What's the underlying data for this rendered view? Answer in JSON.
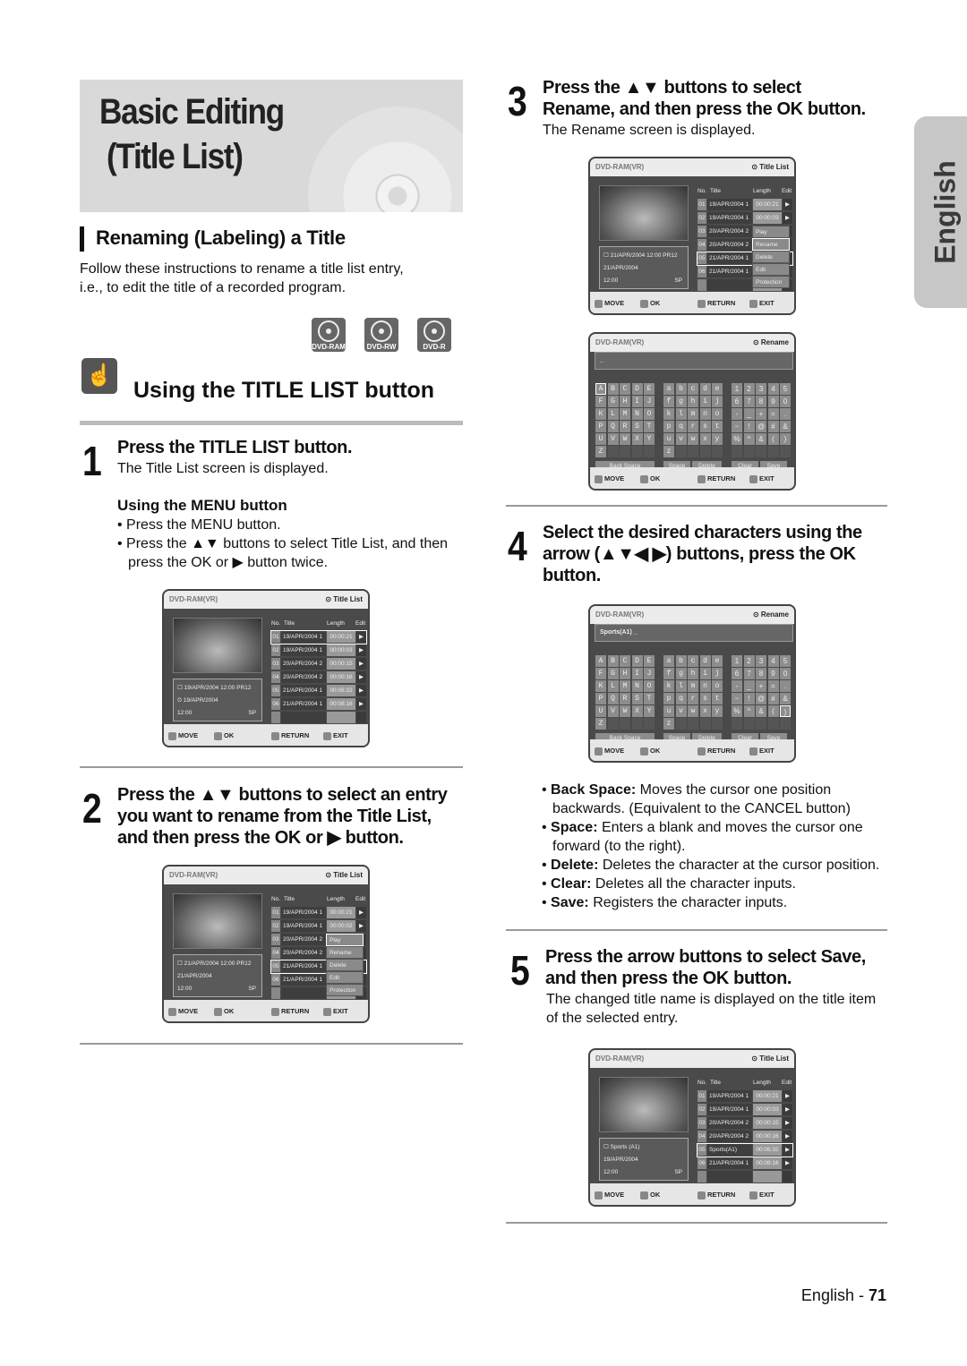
{
  "header": {
    "title_line1": "Basic Editing",
    "title_line2": "(Title List)"
  },
  "side_tab": "English",
  "section": {
    "title": "Renaming (Labeling) a Title",
    "intro_line1": "Follow these instructions to rename a title list entry,",
    "intro_line2": "i.e., to edit the title of a recorded program.",
    "discs": [
      "DVD-RAM",
      "DVD-RW",
      "DVD-R"
    ],
    "subsection_title": "Using the TITLE LIST button"
  },
  "steps": {
    "s1": {
      "num": "1",
      "heading": "Press the TITLE LIST button.",
      "sub": "The Title List screen is displayed.",
      "menu_heading": "Using the MENU button",
      "bullets": [
        "Press the MENU button.",
        "Press the ▲▼ buttons to select Title List, and then",
        "press the OK or ▶ button twice."
      ]
    },
    "s2": {
      "num": "2",
      "lines": [
        "Press the ▲▼ buttons to select an entry",
        "you want to rename from the Title List,",
        "and then press the OK or ▶ button."
      ]
    },
    "s3": {
      "num": "3",
      "lines": [
        "Press the ▲▼ buttons to select",
        "Rename, and then press the OK button."
      ],
      "sub": "The Rename screen is displayed."
    },
    "s4": {
      "num": "4",
      "lines": [
        "Select the desired characters using the",
        "arrow (▲▼◀ ▶) buttons, press the OK",
        "button."
      ]
    },
    "s5": {
      "num": "5",
      "lines": [
        "Press the arrow buttons to select Save,",
        "and then press the OK button."
      ],
      "sub": [
        "The changed title name is displayed on the title item",
        "of the selected entry."
      ]
    }
  },
  "definitions": [
    {
      "term": "Back Space:",
      "text": "Moves the cursor one position",
      "cont": "backwards. (Equivalent to the CANCEL button)"
    },
    {
      "term": "Space:",
      "text": "Enters a blank and moves the cursor one",
      "cont": "forward (to the right)."
    },
    {
      "term": "Delete:",
      "text": "Deletes the character at the cursor position.",
      "cont": ""
    },
    {
      "term": "Clear:",
      "text": "Deletes all the character inputs.",
      "cont": ""
    },
    {
      "term": "Save:",
      "text": "Registers the character inputs.",
      "cont": ""
    }
  ],
  "footer": {
    "lang": "English - ",
    "page": "71"
  },
  "screens": [
    {
      "kind": "list",
      "header_left": "DVD-RAM(VR)",
      "header_right": "⊙ Title List",
      "columns": [
        "No.",
        "Title",
        "Length",
        "Edit"
      ],
      "rows": [
        [
          "01",
          "19/APR/2004 1",
          "00:00:21"
        ],
        [
          "02",
          "19/APR/2004 1",
          "00:00:03"
        ],
        [
          "03",
          "20/APR/2004 2",
          "00:00:15"
        ],
        [
          "04",
          "20/APR/2004 2",
          "00:00:16"
        ],
        [
          "05",
          "21/APR/2004 1",
          "00:06:32"
        ],
        [
          "06",
          "21/APR/2004 1",
          "00:08:16"
        ]
      ],
      "selected_row": 0,
      "info": [
        "☐ 19/APR/2004 12:00 PR12",
        "⏲ 19/APR/2004",
        "12:00",
        "SP"
      ],
      "footer": [
        "MOVE",
        "OK",
        "RETURN",
        "EXIT"
      ]
    },
    {
      "kind": "list",
      "header_left": "DVD-RAM(VR)",
      "header_right": "⊙ Title List",
      "columns": [
        "No.",
        "Title",
        "Length",
        "Edit"
      ],
      "rows": [
        [
          "01",
          "19/APR/2004 1",
          "00:00:21"
        ],
        [
          "02",
          "19/APR/2004 1",
          "00:00:02"
        ],
        [
          "03",
          "20/APR/2004 2",
          ""
        ],
        [
          "04",
          "20/APR/2004 2",
          ""
        ],
        [
          "05",
          "21/APR/2004 1",
          ""
        ],
        [
          "06",
          "21/APR/2004 1",
          ""
        ]
      ],
      "selected_row": 4,
      "info": [
        "☐ 21/APR/2004 12:00 PR12",
        "21/APR/2004",
        "12:00",
        "SP"
      ],
      "menu": [
        "Play",
        "Rename",
        "Delete",
        "Edit",
        "Protection"
      ],
      "menu_selected": 0,
      "footer": [
        "MOVE",
        "OK",
        "RETURN",
        "EXIT"
      ]
    },
    {
      "kind": "list",
      "header_left": "DVD-RAM(VR)",
      "header_right": "⊙ Title List",
      "columns": [
        "No.",
        "Title",
        "Length",
        "Edit"
      ],
      "rows": [
        [
          "01",
          "19/APR/2004 1",
          "00:00:21"
        ],
        [
          "02",
          "19/APR/2004 1",
          "00:00:03"
        ],
        [
          "03",
          "20/APR/2004 2",
          ""
        ],
        [
          "04",
          "20/APR/2004 2",
          ""
        ],
        [
          "05",
          "21/APR/2004 1",
          ""
        ],
        [
          "06",
          "21/APR/2004 1",
          ""
        ]
      ],
      "selected_row": 4,
      "info": [
        "☐ 21/APR/2004 12:00 PR12",
        "21/APR/2004",
        "12:00",
        "SP"
      ],
      "menu": [
        "Play",
        "Rename",
        "Delete",
        "Edit",
        "Protection"
      ],
      "menu_selected": 1,
      "footer": [
        "MOVE",
        "OK",
        "RETURN",
        "EXIT"
      ]
    },
    {
      "kind": "rename",
      "header_left": "DVD-RAM(VR)",
      "header_right": "⊙ Rename",
      "input": "_",
      "upper": [
        "ABCDE",
        "FGHIJ",
        "KLMNO",
        "PQRST",
        "UVWXY",
        "Z"
      ],
      "lower": [
        "abcde",
        "fghij",
        "klmno",
        "pqrst",
        "uvwxy",
        "z"
      ],
      "symbols": [
        [
          "1",
          "2",
          "3",
          "4",
          "5"
        ],
        [
          "6",
          "7",
          "8",
          "9",
          "0"
        ],
        [
          "-",
          "_",
          "+",
          "=",
          "."
        ],
        [
          "~",
          "!",
          "@",
          "#",
          "&"
        ],
        [
          "%",
          "^",
          "&",
          "(",
          ")"
        ]
      ],
      "buttons": [
        "Back Space",
        "Space",
        "Delete",
        "Clear",
        "Save"
      ],
      "selected_key": "A",
      "footer": [
        "MOVE",
        "OK",
        "RETURN",
        "EXIT"
      ]
    },
    {
      "kind": "rename",
      "header_left": "DVD-RAM(VR)",
      "header_right": "⊙ Rename",
      "input": "Sports(A1) _",
      "upper": [
        "ABCDE",
        "FGHIJ",
        "KLMNO",
        "PQRST",
        "UVWXY",
        "Z"
      ],
      "lower": [
        "abcde",
        "fghij",
        "klmno",
        "pqrst",
        "uvwxy",
        "z"
      ],
      "symbols": [
        [
          "1",
          "2",
          "3",
          "4",
          "5"
        ],
        [
          "6",
          "7",
          "8",
          "9",
          "0"
        ],
        [
          "-",
          "_",
          "+",
          "=",
          "."
        ],
        [
          "~",
          "!",
          "@",
          "#",
          "&"
        ],
        [
          "%",
          "^",
          "&",
          "(",
          ")"
        ]
      ],
      "buttons": [
        "Back Space",
        "Space",
        "Delete",
        "Clear",
        "Save"
      ],
      "selected_key": ")",
      "footer": [
        "MOVE",
        "OK",
        "RETURN",
        "EXIT"
      ]
    },
    {
      "kind": "list",
      "header_left": "DVD-RAM(VR)",
      "header_right": "⊙ Title List",
      "columns": [
        "No.",
        "Title",
        "Length",
        "Edit"
      ],
      "rows": [
        [
          "01",
          "19/APR/2004 1",
          "00:00:21"
        ],
        [
          "02",
          "19/APR/2004 1",
          "00:00:03"
        ],
        [
          "03",
          "20/APR/2004 2",
          "00:00:15"
        ],
        [
          "04",
          "20/APR/2004 2",
          "00:00:16"
        ],
        [
          "05",
          "Sports(A1)",
          "00:06:32"
        ],
        [
          "06",
          "21/APR/2004 1",
          "00:08:16"
        ]
      ],
      "selected_row": 4,
      "info": [
        "☐ Sports (A1)",
        "19/APR/2004",
        "12:00",
        "SP"
      ],
      "footer": [
        "MOVE",
        "OK",
        "RETURN",
        "EXIT"
      ]
    }
  ]
}
